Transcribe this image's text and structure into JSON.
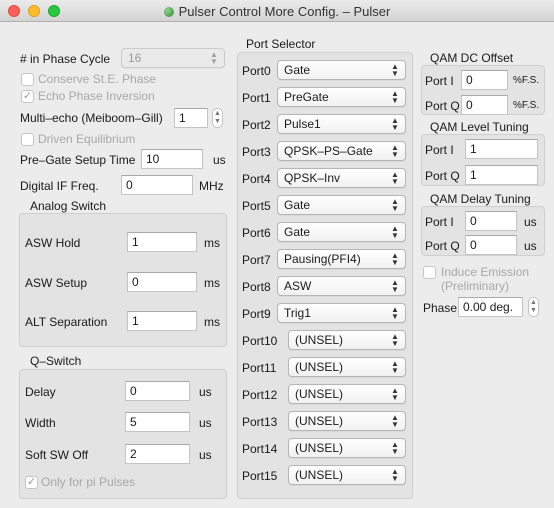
{
  "window": {
    "title": "Pulser Control More Config. – Pulser"
  },
  "left": {
    "phase_cycle": {
      "label": "# in Phase Cycle",
      "value": "16"
    },
    "conserve": {
      "label": "Conserve St.E. Phase",
      "checked": false
    },
    "echo": {
      "label": "Echo Phase Inversion",
      "checked": true
    },
    "multi_echo": {
      "label": "Multi–echo (Meiboom–Gill)",
      "value": "1"
    },
    "driven": {
      "label": "Driven Equilibrium",
      "checked": false
    },
    "pregate": {
      "label": "Pre–Gate Setup Time",
      "value": "10",
      "unit": "us"
    },
    "digital_if": {
      "label": "Digital IF Freq.",
      "value": "0",
      "unit": "MHz"
    },
    "analog_switch": {
      "title": "Analog Switch",
      "rows": [
        {
          "label": "ASW Hold",
          "value": "1",
          "unit": "ms"
        },
        {
          "label": "ASW Setup",
          "value": "0",
          "unit": "ms"
        },
        {
          "label": "ALT Separation",
          "value": "1",
          "unit": "ms"
        }
      ]
    },
    "qswitch": {
      "title": "Q–Switch",
      "rows": [
        {
          "label": "Delay",
          "value": "0",
          "unit": "us"
        },
        {
          "label": "Width",
          "value": "5",
          "unit": "us"
        },
        {
          "label": "Soft SW Off",
          "value": "2",
          "unit": "us"
        }
      ],
      "only_pi": {
        "label": "Only for pi Pulses",
        "checked": true
      }
    }
  },
  "ports": {
    "title": "Port Selector",
    "items": [
      {
        "label": "Port0",
        "value": "Gate"
      },
      {
        "label": "Port1",
        "value": "PreGate"
      },
      {
        "label": "Port2",
        "value": "Pulse1"
      },
      {
        "label": "Port3",
        "value": "QPSK–PS–Gate"
      },
      {
        "label": "Port4",
        "value": "QPSK–Inv"
      },
      {
        "label": "Port5",
        "value": "Gate"
      },
      {
        "label": "Port6",
        "value": "Gate"
      },
      {
        "label": "Port7",
        "value": "Pausing(PFI4)"
      },
      {
        "label": "Port8",
        "value": "ASW"
      },
      {
        "label": "Port9",
        "value": "Trig1"
      },
      {
        "label": "Port10",
        "value": "(UNSEL)"
      },
      {
        "label": "Port11",
        "value": "(UNSEL)"
      },
      {
        "label": "Port12",
        "value": "(UNSEL)"
      },
      {
        "label": "Port13",
        "value": "(UNSEL)"
      },
      {
        "label": "Port14",
        "value": "(UNSEL)"
      },
      {
        "label": "Port15",
        "value": "(UNSEL)"
      }
    ]
  },
  "qam_dc": {
    "title": "QAM DC Offset",
    "rows": [
      {
        "label": "Port I",
        "value": "0",
        "unit": "%F.S."
      },
      {
        "label": "Port Q",
        "value": "0",
        "unit": "%F.S."
      }
    ]
  },
  "qam_level": {
    "title": "QAM Level Tuning",
    "rows": [
      {
        "label": "Port I",
        "value": "1"
      },
      {
        "label": "Port Q",
        "value": "1"
      }
    ]
  },
  "qam_delay": {
    "title": "QAM Delay Tuning",
    "rows": [
      {
        "label": "Port I",
        "value": "0",
        "unit": "us"
      },
      {
        "label": "Port Q",
        "value": "0",
        "unit": "us"
      }
    ]
  },
  "induce": {
    "label_line1": "Induce Emission",
    "label_line2": "(Preliminary)",
    "checked": false
  },
  "phase": {
    "label": "Phase",
    "value": "0.00 deg."
  },
  "icons": {
    "popup_chevron": "up-down-chevron-icon",
    "checkmark": "checkmark-icon",
    "stepper": "stepper-icon"
  }
}
